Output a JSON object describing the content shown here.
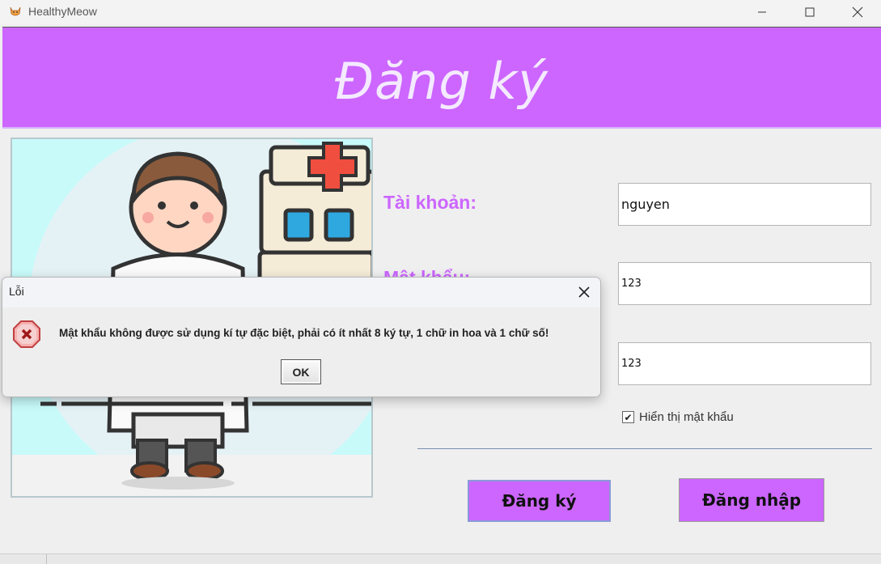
{
  "window": {
    "title": "HealthyMeow",
    "icon": "cat-icon"
  },
  "header": {
    "title": "Đăng ký",
    "background": "#cc66ff"
  },
  "form": {
    "account_label": "Tài khoản:",
    "account_value": "nguyen",
    "password_label": "Mật khẩu:",
    "password_value": "123",
    "confirm_value": "123",
    "show_password_label": "Hiển thị mật khẩu",
    "show_password_checked": true
  },
  "buttons": {
    "register": "Đăng ký",
    "login": "Đăng nhập"
  },
  "dialog": {
    "title": "Lỗi",
    "message": "Mật khẩu không được sử dụng kí tự đặc biệt, phải có ít nhất 8 ký tự, 1 chữ in hoa và 1 chữ số!",
    "ok_label": "OK",
    "icon": "error-icon"
  },
  "colors": {
    "accent": "#cc66ff",
    "illustration_bg": "#c8fafa"
  }
}
